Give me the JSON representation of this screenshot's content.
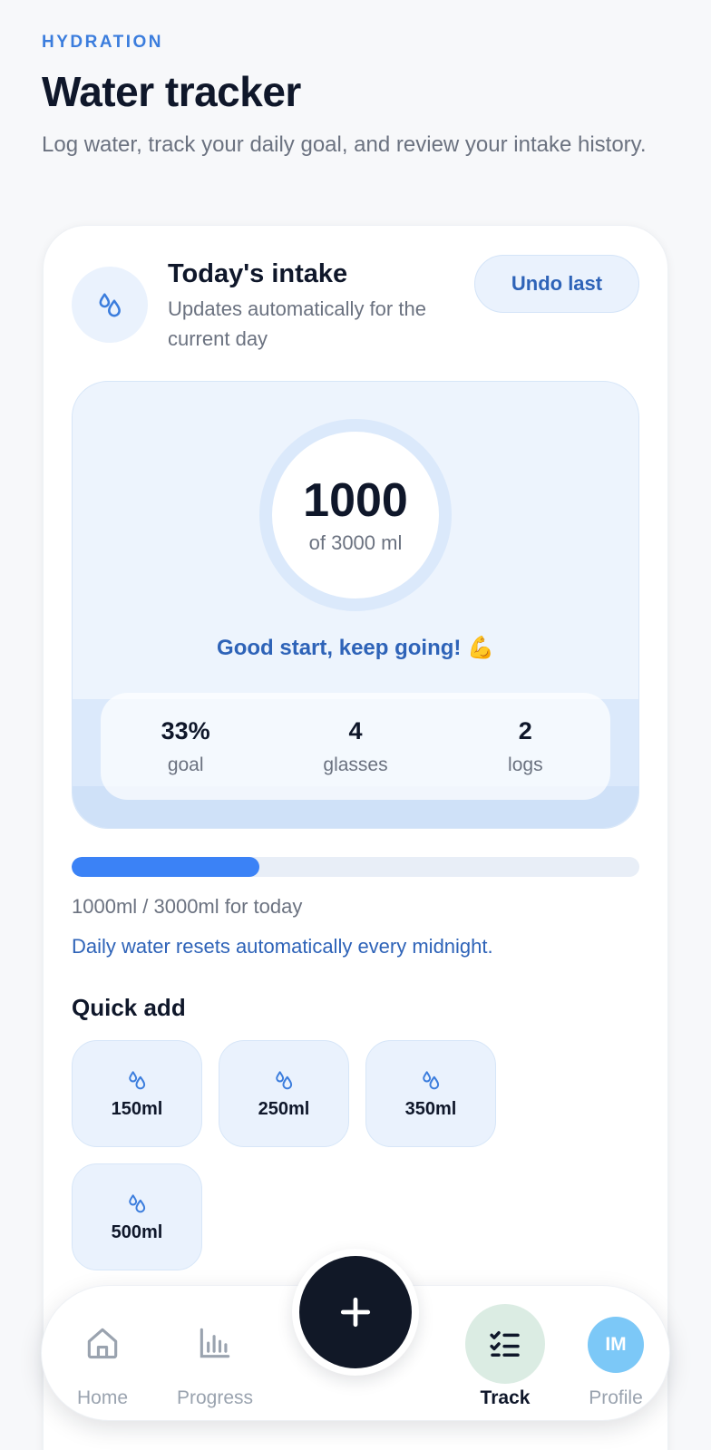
{
  "header": {
    "eyebrow": "HYDRATION",
    "title": "Water tracker",
    "subtitle": "Log water, track your daily goal, and review your intake history."
  },
  "today": {
    "title": "Today's intake",
    "subtitle": "Updates automatically for the current day",
    "undo_label": "Undo last",
    "icon": "water-drops-icon",
    "ring_value": "1000",
    "ring_of": "of 3000 ml",
    "encouragement": "Good start, keep going! 💪",
    "stats": [
      {
        "value": "33%",
        "label": "goal"
      },
      {
        "value": "4",
        "label": "glasses"
      },
      {
        "value": "2",
        "label": "logs"
      }
    ],
    "progress_fraction": 0.33,
    "progress_caption": "1000ml / 3000ml for today",
    "reset_note": "Daily water resets automatically every midnight."
  },
  "quick_add": {
    "title": "Quick add",
    "icon": "water-drops-icon",
    "options": [
      {
        "label": "150ml"
      },
      {
        "label": "250ml"
      },
      {
        "label": "350ml"
      },
      {
        "label": "500ml"
      }
    ]
  },
  "nav": {
    "items": [
      {
        "label": "Home",
        "icon": "home-icon"
      },
      {
        "label": "Progress",
        "icon": "bar-chart-icon"
      },
      {
        "label": "Track",
        "icon": "checklist-icon",
        "active": true
      },
      {
        "label": "Profile",
        "icon": "avatar",
        "initials": "IM"
      }
    ],
    "fab_icon": "plus-icon"
  },
  "colors": {
    "accent": "#3b82f6",
    "accent_text": "#2e63b8",
    "fab": "#111827",
    "avatar": "#7cc8f7",
    "track_bubble": "#dbece3"
  }
}
